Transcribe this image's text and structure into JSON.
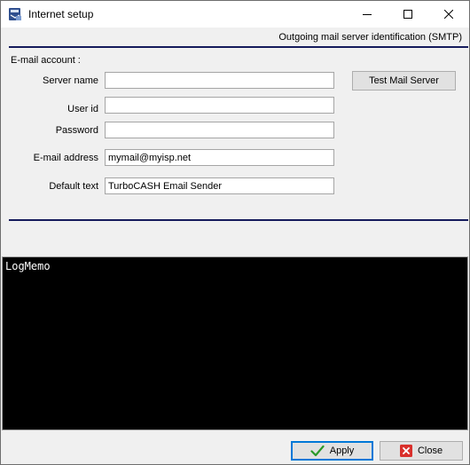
{
  "window": {
    "title": "Internet setup",
    "app_icon": "app-icon",
    "controls": [
      "minimize-icon",
      "maximize-icon",
      "close-icon"
    ]
  },
  "header": {
    "caption": "Outgoing mail server identification (SMTP)"
  },
  "account": {
    "group_caption": "E-mail account :",
    "fields": {
      "server_name": {
        "label": "Server name",
        "value": ""
      },
      "user_id": {
        "label": "User id",
        "value": ""
      },
      "password": {
        "label": "Password",
        "value": ""
      },
      "email_address": {
        "label": "E-mail address",
        "value": "mymail@myisp.net"
      },
      "default_text": {
        "label": "Default text",
        "value": "TurboCASH Email Sender"
      }
    },
    "test_button": "Test Mail Server"
  },
  "log": {
    "text": "LogMemo"
  },
  "footer": {
    "apply_label": "Apply",
    "apply_icon": "checkmark-icon",
    "close_label": "Close",
    "close_icon": "close-x-icon"
  },
  "colors": {
    "separator": "#151b5c",
    "log_background": "#000000",
    "apply_focus": "#0078d7",
    "close_icon_red": "#d9302c",
    "check_green": "#2a9a2a"
  }
}
